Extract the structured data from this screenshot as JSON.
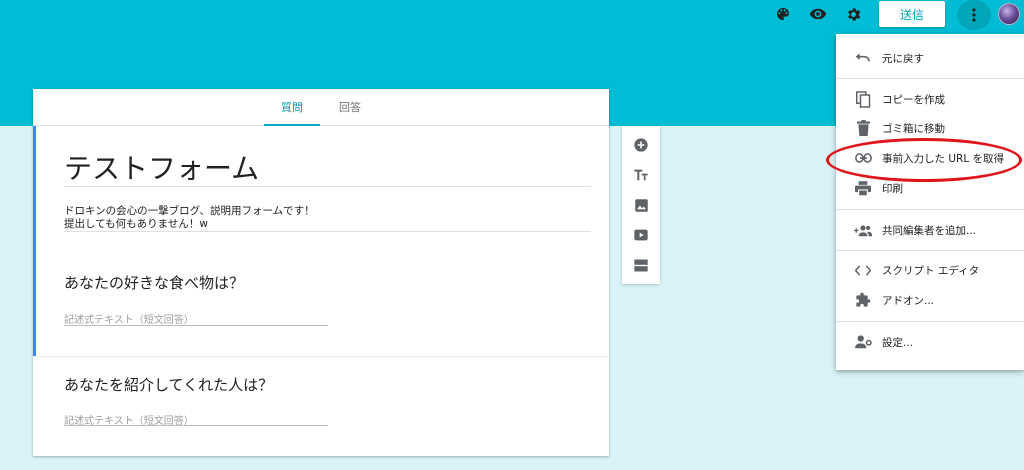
{
  "header": {
    "send_label": "送信",
    "icons": [
      "palette-icon",
      "eye-icon",
      "gear-icon",
      "more-vert-icon",
      "avatar"
    ]
  },
  "tabs": [
    {
      "label": "質問",
      "active": true
    },
    {
      "label": "回答",
      "active": false
    }
  ],
  "form": {
    "title": "テストフォーム",
    "description": "ドロキンの会心の一撃ブログ、説明用フォームです！\n提出しても何もありません！w",
    "questions": [
      {
        "title": "あなたの好きな食べ物は？",
        "placeholder": "記述式テキスト（短文回答）"
      },
      {
        "title": "あなたを紹介してくれた人は？",
        "placeholder": "記述式テキスト（短文回答）"
      }
    ]
  },
  "sidebar": {
    "items": [
      "add-question-icon",
      "title-text-icon",
      "image-icon",
      "video-icon",
      "section-icon"
    ]
  },
  "menu": {
    "items": [
      {
        "label": "元に戻す",
        "icon": "undo-icon"
      },
      {
        "label": "コピーを作成",
        "icon": "copy-icon"
      },
      {
        "label": "ゴミ箱に移動",
        "icon": "trash-icon"
      },
      {
        "label": "事前入力した URL を取得",
        "icon": "link-icon"
      },
      {
        "label": "印刷",
        "icon": "print-icon"
      },
      {
        "label": "共同編集者を追加...",
        "icon": "add-people-icon"
      },
      {
        "label": "スクリプト エディタ",
        "icon": "code-icon"
      },
      {
        "label": "アドオン...",
        "icon": "puzzle-icon"
      },
      {
        "label": "設定...",
        "icon": "person-settings-icon"
      }
    ]
  },
  "colors": {
    "header": "#00bcd4",
    "background": "#d9f3f8",
    "accent": "#4285f4",
    "highlight": "#e0151b"
  }
}
